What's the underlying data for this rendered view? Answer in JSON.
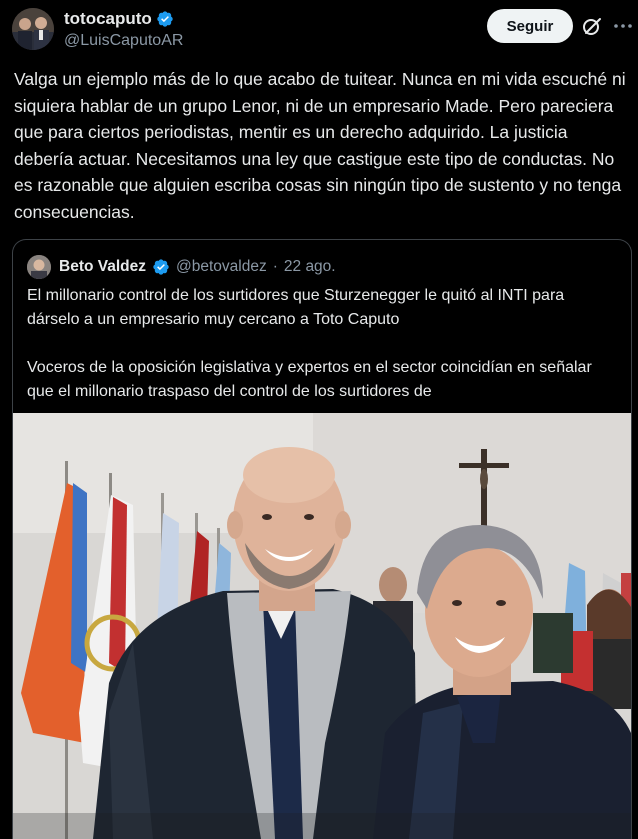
{
  "tweet": {
    "author": {
      "display_name": "totocaputo",
      "handle": "@LuisCaputoAR",
      "verified": true
    },
    "follow_label": "Seguir",
    "more_icon": "more-horizontal-icon",
    "grok_icon": "grok-icon",
    "text": "Valga un ejemplo más de lo que acabo de tuitear. Nunca en mi vida escuché ni siquiera hablar de un grupo Lenor, ni de un empresario Made. Pero pareciera que para ciertos periodistas, mentir es un derecho adquirido. La justicia debería actuar. Necesitamos una ley que castigue este tipo de conductas. No es razonable que alguien escriba cosas sin ningún tipo de sustento y no tenga consecuencias."
  },
  "quote": {
    "author": {
      "display_name": "Beto Valdez",
      "handle": "@betovaldez",
      "verified": true
    },
    "separator": "·",
    "date": "22 ago.",
    "paragraphs": [
      "El millonario control de los surtidores que Sturzenegger le quitó al INTI para dárselo a un empresario muy cercano a Toto Caputo",
      "Voceros de la oposición legislativa y expertos en el sector coincidían en señalar que el millonario traspaso del control de los surtidores de"
    ]
  },
  "colors": {
    "background": "#000000",
    "text": "#e7e9ea",
    "secondary_text": "#8b98a5",
    "verified_blue": "#1d9bf0",
    "follow_button_bg": "#eff3f4",
    "card_border": "#3d4247"
  }
}
